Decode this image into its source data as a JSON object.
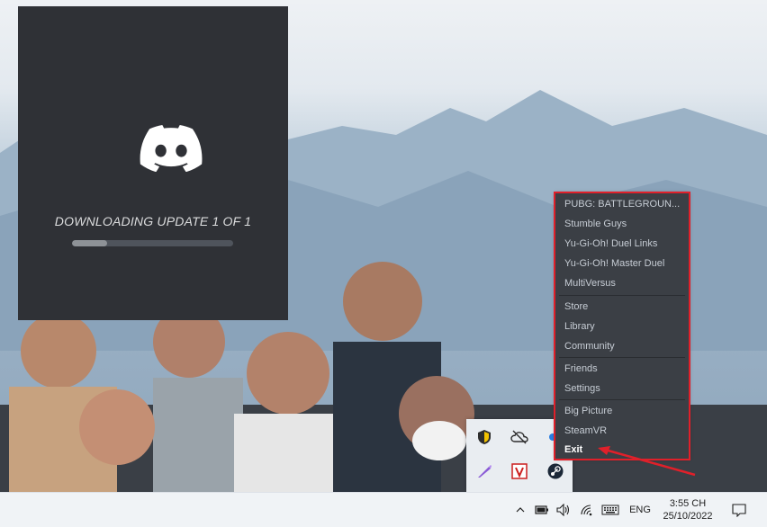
{
  "discord": {
    "status_text": "DOWNLOADING UPDATE 1 OF 1",
    "progress_fraction": 0.22
  },
  "steam_menu": {
    "games": [
      "PUBG: BATTLEGROUN...",
      "Stumble Guys",
      "Yu-Gi-Oh! Duel Links",
      "Yu-Gi-Oh!  Master Duel",
      "MultiVersus"
    ],
    "store": "Store",
    "library": "Library",
    "community": "Community",
    "friends": "Friends",
    "settings": "Settings",
    "big_picture": "Big Picture",
    "steamvr": "SteamVR",
    "exit": "Exit"
  },
  "tray_overflow_icons": [
    "windows-security-icon",
    "onedrive-offline-icon",
    "pen-icon",
    "v-app-icon",
    "steam-icon",
    "partial-blue-icon"
  ],
  "taskbar": {
    "language": "ENG",
    "time": "3:55 CH",
    "date": "25/10/2022"
  },
  "colors": {
    "discord_bg": "#2f3136",
    "menu_bg": "#3b3f45",
    "highlight_red": "#e0202a"
  }
}
